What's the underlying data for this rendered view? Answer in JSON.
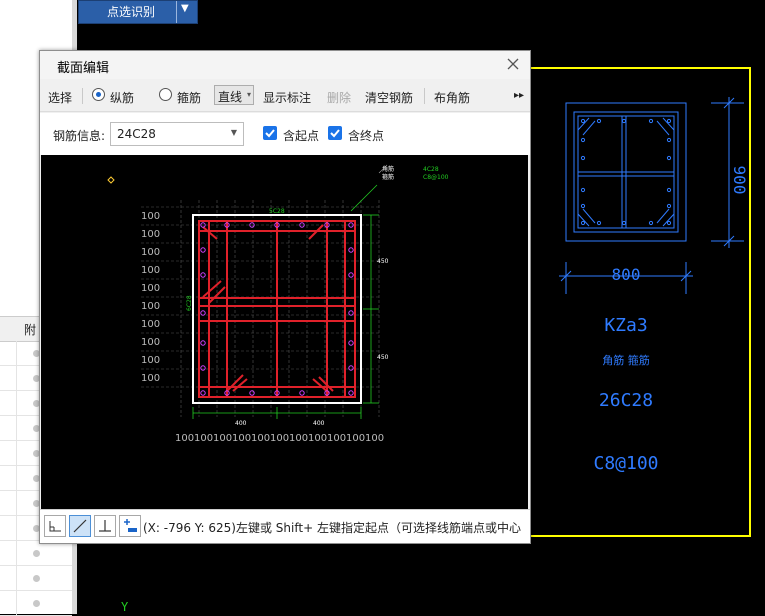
{
  "top_button": {
    "label": "点选识别"
  },
  "left_panel": {
    "column_header": "附"
  },
  "dialog": {
    "title": "截面编辑",
    "toolbar": {
      "select": "选择",
      "longitudinal": "纵筋",
      "stirrup": "箍筋",
      "line_mode": "直线",
      "show_annotation": "显示标注",
      "delete": "删除",
      "clear_rebar": "清空钢筋",
      "corner_rebar": "布角筋",
      "more": "▸▸"
    },
    "info": {
      "label": "钢筋信息:",
      "value": "24C28",
      "include_start": "含起点",
      "include_end": "含终点"
    },
    "drawing": {
      "top_side_label": "5C28",
      "left_side_label": "6C28",
      "legend_corner": "角筋",
      "legend_stirrup": "箍筋",
      "legend_corner_value": "4C28",
      "legend_stirrup_value": "C8@100",
      "right_dims": [
        "450",
        "450"
      ],
      "bottom_dims": [
        "400",
        "400"
      ],
      "left_grid_labels": [
        "100",
        "100",
        "100",
        "100",
        "100",
        "100",
        "100",
        "100",
        "100",
        "100"
      ],
      "bottom_grid_labels": [
        "100",
        "100",
        "100",
        "100",
        "100",
        "100",
        "100",
        "100",
        "100",
        "100",
        "100"
      ]
    },
    "status": {
      "text": "(X: -796 Y: 625)左键或 Shift+ 左键指定起点（可选择线筋端点或中心"
    }
  },
  "cad": {
    "dim_height": "900",
    "dim_width": "800",
    "column_name": "KZa3",
    "note": "角筋 箍筋",
    "rebar": "26C28",
    "stirrup": "C8@100",
    "axis": "Y"
  },
  "colors": {
    "cad_yellow": "#ffff00",
    "cad_blue": "#2f7bff",
    "rebar_red": "#e0212a",
    "dim_green": "#22cc22",
    "point_magenta": "#d040ff"
  }
}
